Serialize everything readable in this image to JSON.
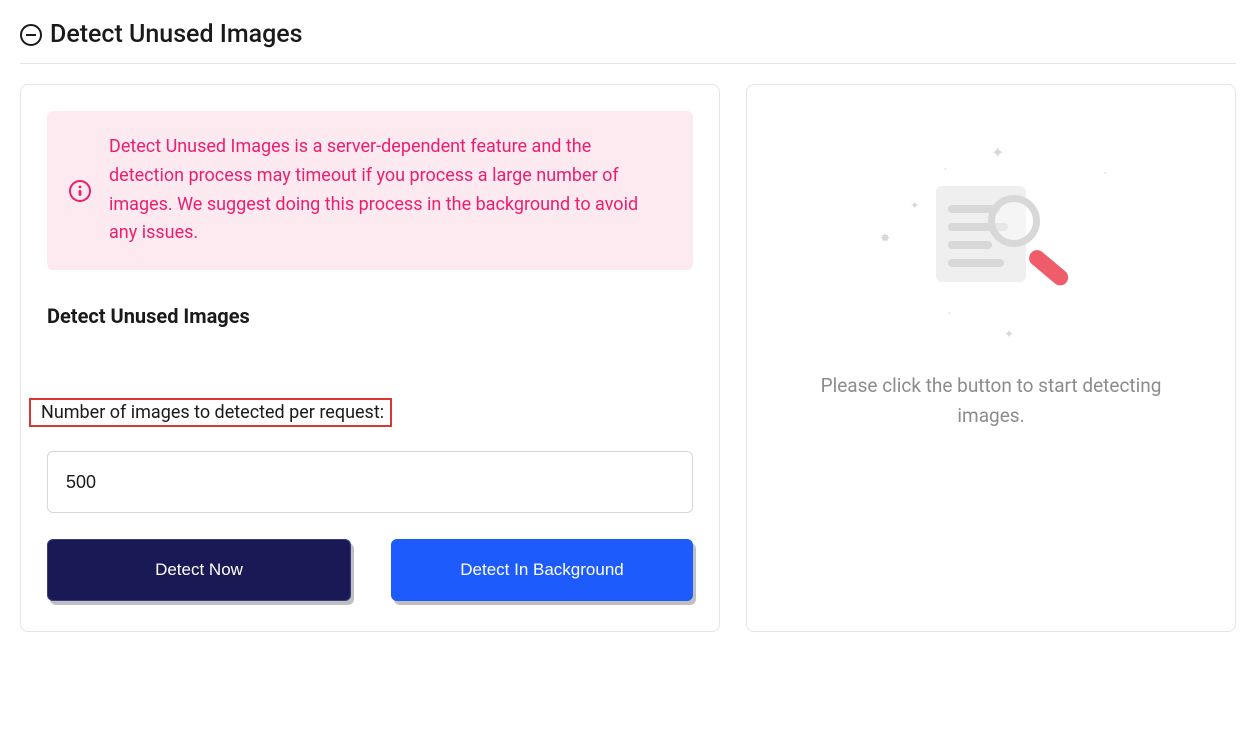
{
  "header": {
    "title": "Detect Unused Images"
  },
  "info_banner": {
    "text": "Detect Unused Images is a server-dependent feature and the detection process may timeout if you process a large number of images. We suggest doing this process in the background to avoid any issues."
  },
  "form": {
    "heading": "Detect Unused Images",
    "input_label": "Number of images to detected per request:",
    "input_value": "500",
    "detect_now_label": "Detect Now",
    "detect_bg_label": "Detect In Background"
  },
  "placeholder": {
    "text": "Please click the button to start detecting images."
  },
  "colors": {
    "accent_pink": "#ec1e71",
    "btn_dark": "#191955",
    "btn_blue": "#1d5bfd"
  }
}
